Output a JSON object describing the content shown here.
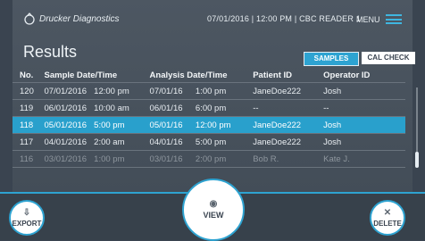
{
  "header": {
    "brand": "Drucker Diagnostics",
    "date": "07/01/2016",
    "time": "12:00 PM",
    "device": "CBC READER 1",
    "menu_label": "MENU"
  },
  "page_title": "Results",
  "tabs": {
    "samples": "SAMPLES",
    "cal_check": "CAL CHECK"
  },
  "table": {
    "headers": [
      "No.",
      "Sample Date/Time",
      "Analysis Date/Time",
      "Patient ID",
      "Operator ID"
    ],
    "rows": [
      [
        "120",
        "07/01/2016",
        "12:00 pm",
        "07/01/16",
        "1:00 pm",
        "JaneDoe222",
        "Josh"
      ],
      [
        "119",
        "06/01/2016",
        "10:00 am",
        "06/01/16",
        "6:00 pm",
        "--",
        "--"
      ],
      [
        "118",
        "05/01/2016",
        "5:00 pm",
        "05/01/16",
        "12:00 pm",
        "JaneDoe222",
        "Josh"
      ],
      [
        "117",
        "04/01/2016",
        "2:00 am",
        "04/01/16",
        "5:00 pm",
        "JaneDoe222",
        "Josh"
      ],
      [
        "116",
        "03/01/2016",
        "1:00 pm",
        "03/01/16",
        "2:00 pm",
        "Bob R.",
        "Kate J."
      ]
    ]
  },
  "buttons": {
    "export": "EXPORT",
    "view": "VIEW",
    "delete": "DELETE"
  },
  "colors": {
    "accent": "#2ea3d1",
    "selected_row": "#29a0cc",
    "background": "#4a545f"
  }
}
